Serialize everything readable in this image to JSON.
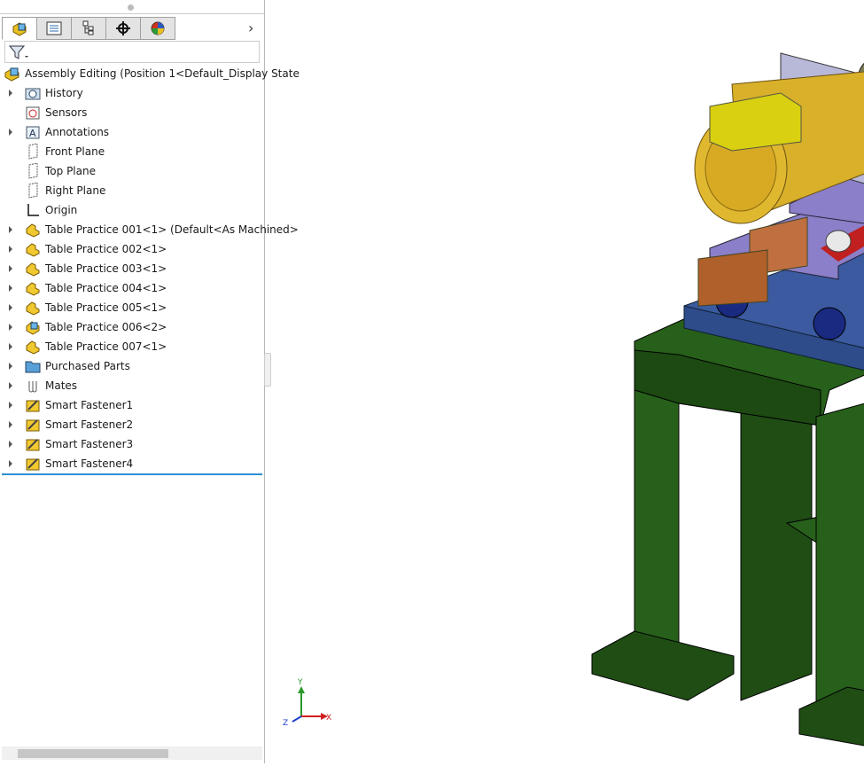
{
  "tabs": [
    {
      "name": "featuremanager-icon"
    },
    {
      "name": "propertymanager-icon"
    },
    {
      "name": "configurationmanager-icon"
    },
    {
      "name": "dimxpertmanager-icon"
    },
    {
      "name": "displaymanager-icon"
    }
  ],
  "tree": {
    "root": "Assembly Editing  (Position 1<Default_Display State",
    "items": [
      {
        "label": "History",
        "icon": "history-folder-icon",
        "expand": true
      },
      {
        "label": "Sensors",
        "icon": "sensors-icon",
        "expand": false
      },
      {
        "label": "Annotations",
        "icon": "annotations-icon",
        "expand": true
      },
      {
        "label": "Front Plane",
        "icon": "plane-icon",
        "expand": false
      },
      {
        "label": "Top Plane",
        "icon": "plane-icon",
        "expand": false
      },
      {
        "label": "Right Plane",
        "icon": "plane-icon",
        "expand": false
      },
      {
        "label": "Origin",
        "icon": "origin-icon",
        "expand": false
      },
      {
        "label": "Table Practice 001<1>  (Default<As Machined>",
        "icon": "part-icon",
        "expand": true
      },
      {
        "label": "Table Practice 002<1>",
        "icon": "part-icon",
        "expand": true
      },
      {
        "label": "Table Practice 003<1>",
        "icon": "part-icon",
        "expand": true
      },
      {
        "label": "Table Practice 004<1>",
        "icon": "part-icon",
        "expand": true
      },
      {
        "label": "Table Practice 005<1>",
        "icon": "part-icon",
        "expand": true
      },
      {
        "label": "Table Practice 006<2>",
        "icon": "subassembly-icon",
        "expand": true
      },
      {
        "label": "Table Practice 007<1>",
        "icon": "part-icon",
        "expand": true
      },
      {
        "label": "Purchased Parts",
        "icon": "folder-icon",
        "expand": true
      },
      {
        "label": "Mates",
        "icon": "mates-icon",
        "expand": true
      },
      {
        "label": "Smart Fastener1",
        "icon": "smart-fastener-icon",
        "expand": true
      },
      {
        "label": "Smart Fastener2",
        "icon": "smart-fastener-icon",
        "expand": true
      },
      {
        "label": "Smart Fastener3",
        "icon": "smart-fastener-icon",
        "expand": true
      },
      {
        "label": "Smart Fastener4",
        "icon": "smart-fastener-icon",
        "expand": true
      }
    ]
  },
  "triad": {
    "x": "X",
    "y": "Y",
    "z": "Z"
  },
  "colors": {
    "frame": "#1f4d14",
    "plate": "#3b5aa0",
    "upper_plate": "#8a7fc8",
    "motor": "#d8b02a",
    "selection": "#2b8fd6"
  }
}
